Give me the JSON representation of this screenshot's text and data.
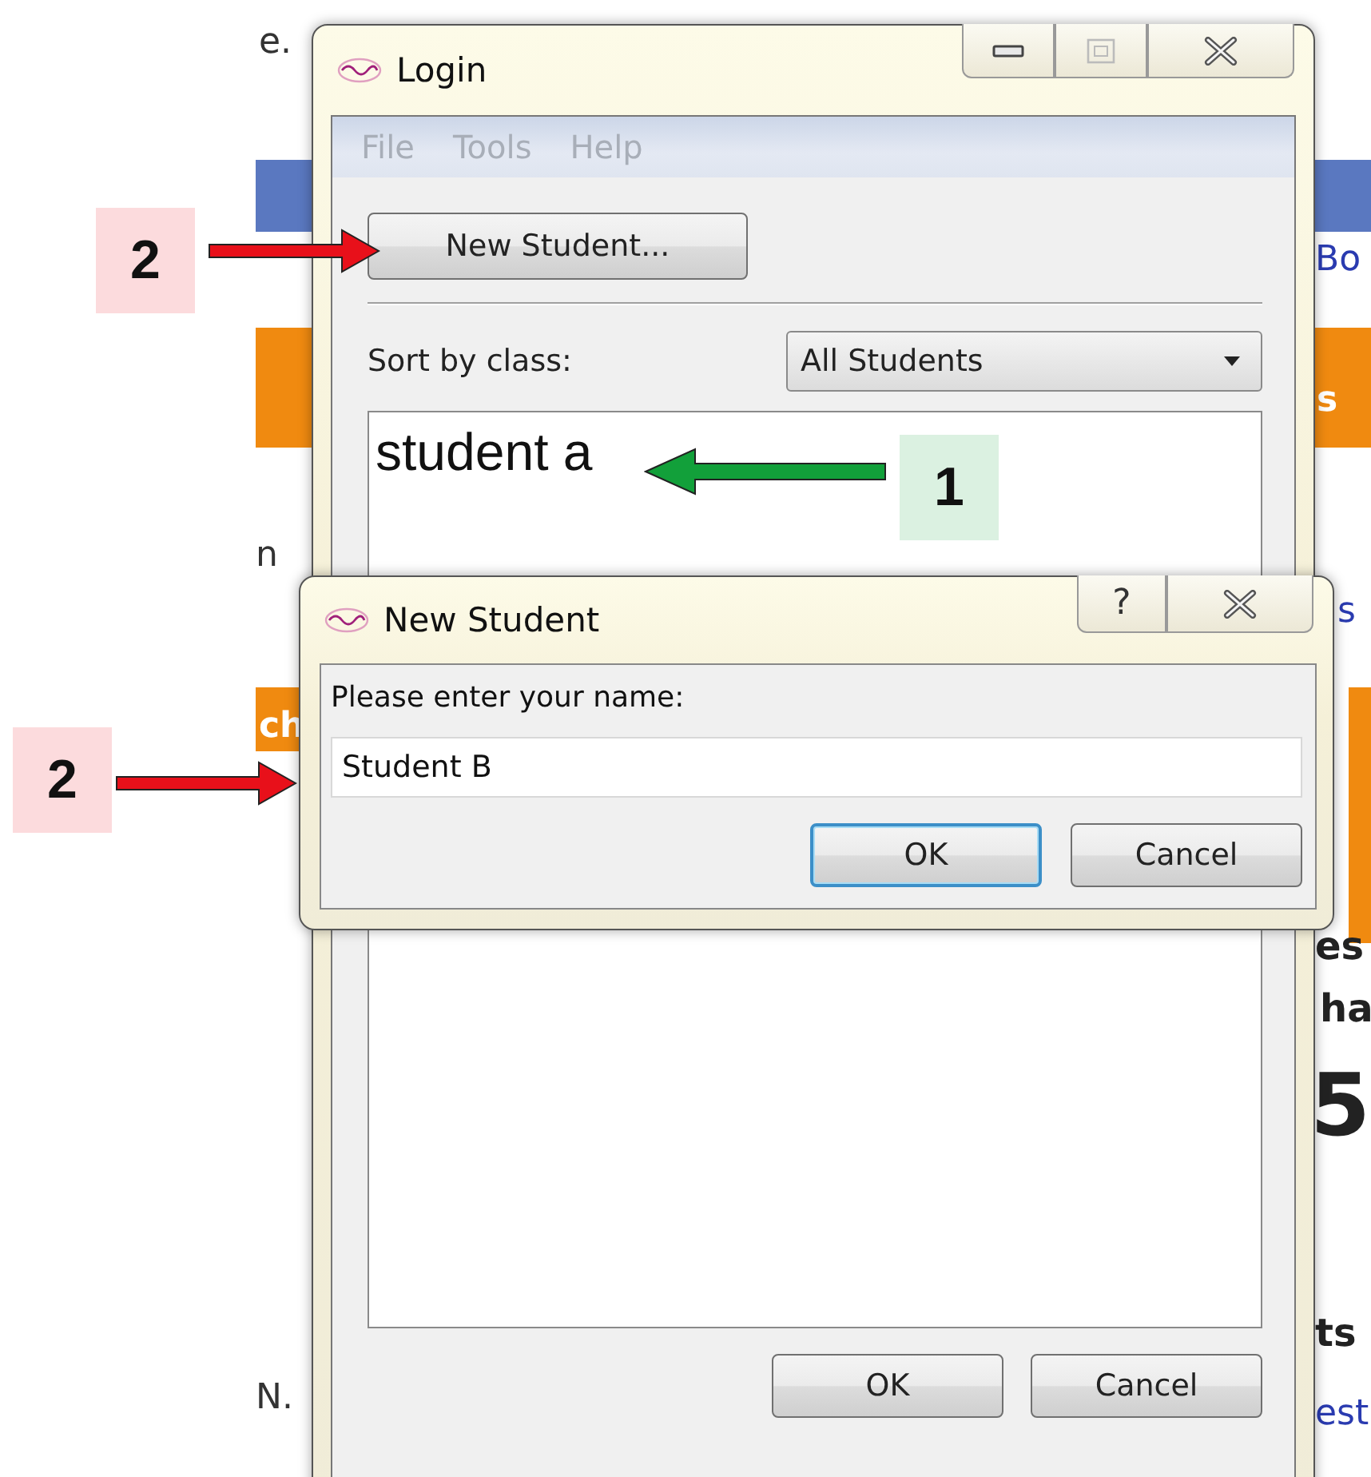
{
  "background_page": {
    "fragments": [
      {
        "text": "e.",
        "kind": "plain"
      },
      {
        "text": "Bo",
        "kind": "link"
      },
      {
        "text": "s",
        "kind": "tab"
      },
      {
        "text": "n",
        "kind": "plain"
      },
      {
        "text": "s",
        "kind": "link"
      },
      {
        "text": "ch",
        "kind": "tab"
      },
      {
        "text": "es",
        "kind": "heading"
      },
      {
        "text": "ha",
        "kind": "heading"
      },
      {
        "text": "5",
        "kind": "big"
      },
      {
        "text": "ts",
        "kind": "heading"
      },
      {
        "text": "N.",
        "kind": "plain"
      },
      {
        "text": "est",
        "kind": "link"
      }
    ]
  },
  "login_window": {
    "title": "Login",
    "menu": [
      {
        "label": "File",
        "disabled": true
      },
      {
        "label": "Tools",
        "disabled": true
      },
      {
        "label": "Help",
        "disabled": true
      }
    ],
    "new_student_button": "New Student...",
    "sort_label": "Sort by class:",
    "class_dropdown": "All Students",
    "students": [
      {
        "name": "student a"
      }
    ],
    "buttons": [
      {
        "label": "OK",
        "default": false
      },
      {
        "label": "Cancel",
        "default": false
      }
    ]
  },
  "new_student_dialog": {
    "title": "New Student",
    "help_button": "?",
    "prompt": "Please enter your name:",
    "name_field": {
      "value": "Student B"
    },
    "buttons": [
      {
        "label": "OK",
        "default": true
      },
      {
        "label": "Cancel",
        "default": false
      }
    ]
  },
  "annotations": [
    {
      "number": "2",
      "color": "#e8101a"
    },
    {
      "number": "1",
      "color": "#12a03a"
    },
    {
      "number": "2",
      "color": "#e8101a"
    }
  ]
}
